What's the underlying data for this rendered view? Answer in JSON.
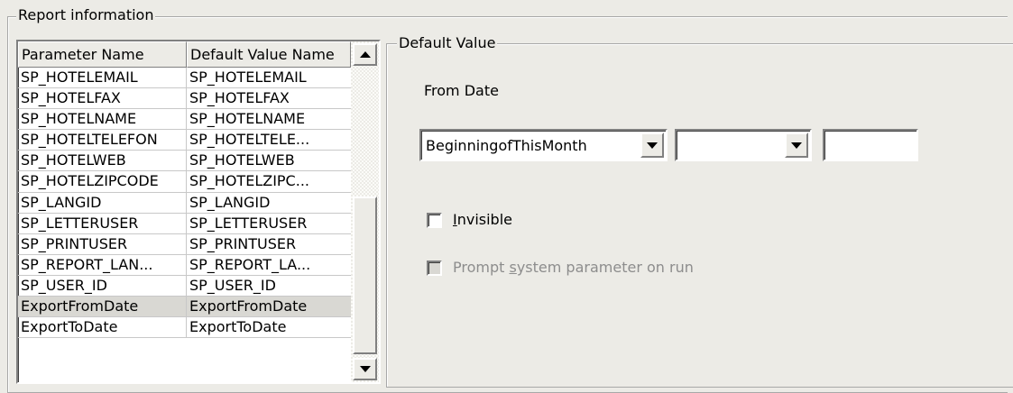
{
  "report_group": {
    "legend": "Report information"
  },
  "param_list": {
    "headers": [
      "Parameter Name",
      "Default Value Name"
    ],
    "rows": [
      [
        "SP_HOTELEMAIL",
        "SP_HOTELEMAIL"
      ],
      [
        "SP_HOTELFAX",
        "SP_HOTELFAX"
      ],
      [
        "SP_HOTELNAME",
        "SP_HOTELNAME"
      ],
      [
        "SP_HOTELTELEFON",
        "SP_HOTELTELE..."
      ],
      [
        "SP_HOTELWEB",
        "SP_HOTELWEB"
      ],
      [
        "SP_HOTELZIPCODE",
        "SP_HOTELZIPC..."
      ],
      [
        "SP_LANGID",
        "SP_LANGID"
      ],
      [
        "SP_LETTERUSER",
        "SP_LETTERUSER"
      ],
      [
        "SP_PRINTUSER",
        "SP_PRINTUSER"
      ],
      [
        "SP_REPORT_LAN...",
        "SP_REPORT_LA..."
      ],
      [
        "SP_USER_ID",
        "SP_USER_ID"
      ],
      [
        "ExportFromDate",
        "ExportFromDate"
      ],
      [
        "ExportToDate",
        "ExportToDate"
      ]
    ],
    "selected_row": "ExportFromDate"
  },
  "default_value": {
    "legend": "Default Value",
    "from_date_label": "From Date",
    "combo1_value": "BeginningofThisMonth",
    "combo2_value": "",
    "text_value": ""
  },
  "invisible": {
    "accel": "I",
    "rest": "nvisible",
    "checked": false
  },
  "prompt": {
    "before": "Prompt ",
    "accel": "s",
    "after": "ystem parameter on run",
    "checked": false,
    "enabled": false
  },
  "icons": [
    "scroll-up-arrow-icon",
    "scroll-down-arrow-icon",
    "dropdown-arrow-icon"
  ]
}
